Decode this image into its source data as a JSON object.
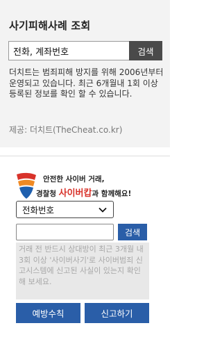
{
  "thecheat": {
    "title": "사기피해사례 조회",
    "search_value": "전화, 계좌번호",
    "search_button": "검색",
    "info": "더치트는 범죄피해 방지를 위해 2006년부터 운영되고 있습니다. 최근 6개월내 1회 이상 등록된 정보를 확인 할 수 있습니다.",
    "source": "제공: 더치트(TheCheat.co.kr)"
  },
  "cybercop": {
    "banner_line1": "안전한 사이버 거래,",
    "banner_line2_prefix": "경찰청 ",
    "banner_brand": "사이버캅",
    "banner_line2_suffix": "과 함께해요!",
    "select_value": "전화번호",
    "search_button": "검색",
    "notice": "거래 전 반드시 상대방이 최근 3개월 내 3회 이상 '사이버사기'로 사이버범죄 신고시스템에 신고된 사실이 있는지 확인해 보세요.",
    "prevention_button": "예방수칙",
    "report_button": "신고하기"
  },
  "colors": {
    "panel_bg": "#f3f3f3",
    "dark_button": "#4a4a4a",
    "blue_button": "#2a5ea8",
    "brand_red": "#d8322a"
  },
  "icons": {
    "banner_logo": "cybercop-logo-icon",
    "select_arrow": "chevron-down-icon"
  }
}
